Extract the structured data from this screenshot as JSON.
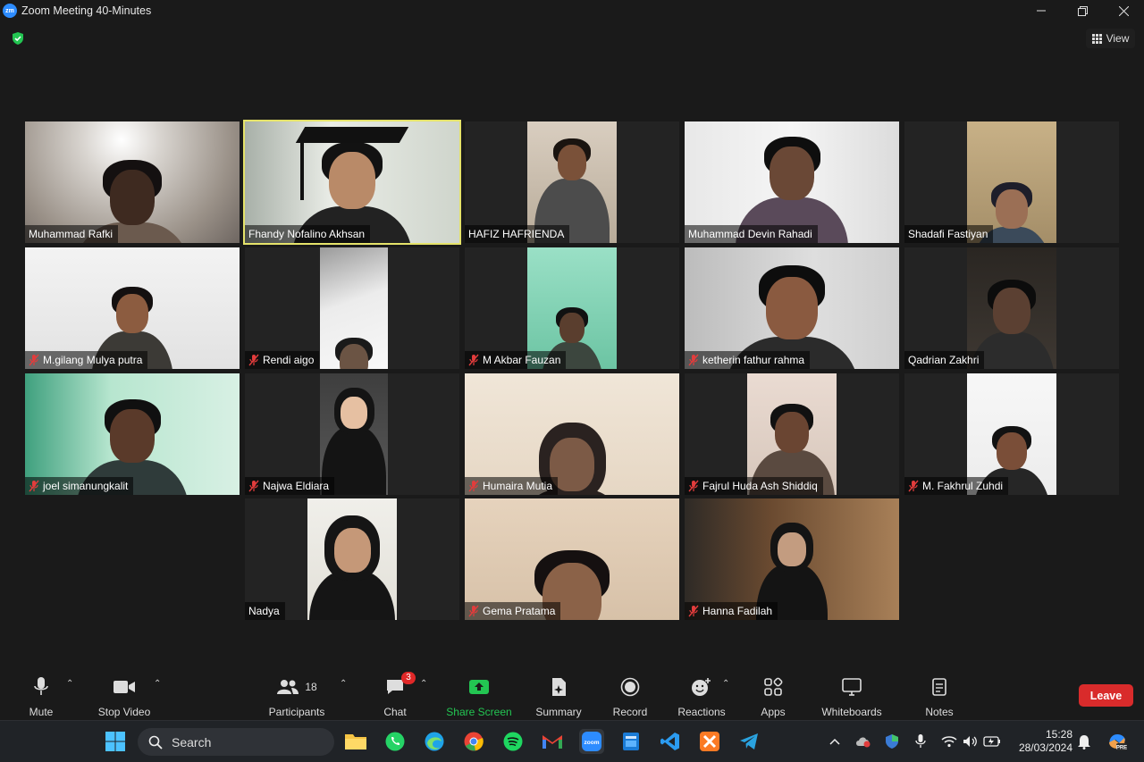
{
  "window": {
    "title": "Zoom Meeting 40-Minutes",
    "app_icon_text": "zm"
  },
  "view_button": {
    "label": "View"
  },
  "participants_grid": [
    {
      "name": "Muhammad Rafki",
      "muted": false,
      "speaking": false
    },
    {
      "name": "Fhandy Nofalino Akhsan",
      "muted": false,
      "speaking": true
    },
    {
      "name": "HAFIZ HAFRIENDA",
      "muted": false,
      "speaking": false
    },
    {
      "name": "Muhammad Devin Rahadi",
      "muted": false,
      "speaking": false
    },
    {
      "name": "Shadafi Fastiyan",
      "muted": false,
      "speaking": false
    },
    {
      "name": "M.gilang Mulya putra",
      "muted": true,
      "speaking": false
    },
    {
      "name": "Rendi aigo",
      "muted": true,
      "speaking": false
    },
    {
      "name": "M Akbar Fauzan",
      "muted": true,
      "speaking": false
    },
    {
      "name": "ketherin fathur rahma",
      "muted": true,
      "speaking": false
    },
    {
      "name": "Qadrian Zakhri",
      "muted": false,
      "speaking": false
    },
    {
      "name": "joel simanungkalit",
      "muted": true,
      "speaking": false
    },
    {
      "name": "Najwa Eldiara",
      "muted": true,
      "speaking": false
    },
    {
      "name": "Humaira Mutia",
      "muted": true,
      "speaking": false
    },
    {
      "name": "Fajrul Huda Ash Shiddiq",
      "muted": true,
      "speaking": false
    },
    {
      "name": "M. Fakhrul Zuhdi",
      "muted": true,
      "speaking": false
    },
    {
      "name": "Nadya",
      "muted": false,
      "speaking": false
    },
    {
      "name": "Gema Pratama",
      "muted": true,
      "speaking": false
    },
    {
      "name": "Hanna Fadilah",
      "muted": true,
      "speaking": false
    }
  ],
  "toolbar": {
    "mute": "Mute",
    "stop_video": "Stop Video",
    "participants": "Participants",
    "participants_count": "18",
    "chat": "Chat",
    "chat_badge": "3",
    "share_screen": "Share Screen",
    "summary": "Summary",
    "record": "Record",
    "reactions": "Reactions",
    "apps": "Apps",
    "whiteboards": "Whiteboards",
    "notes": "Notes",
    "leave": "Leave"
  },
  "taskbar": {
    "search_placeholder": "Search",
    "time": "15:28",
    "date": "28/03/2024"
  },
  "colors": {
    "speaking_border": "#e5e36a",
    "share_green": "#23c552",
    "leave_red": "#d92b2b",
    "zoom_blue": "#2d8cff"
  }
}
